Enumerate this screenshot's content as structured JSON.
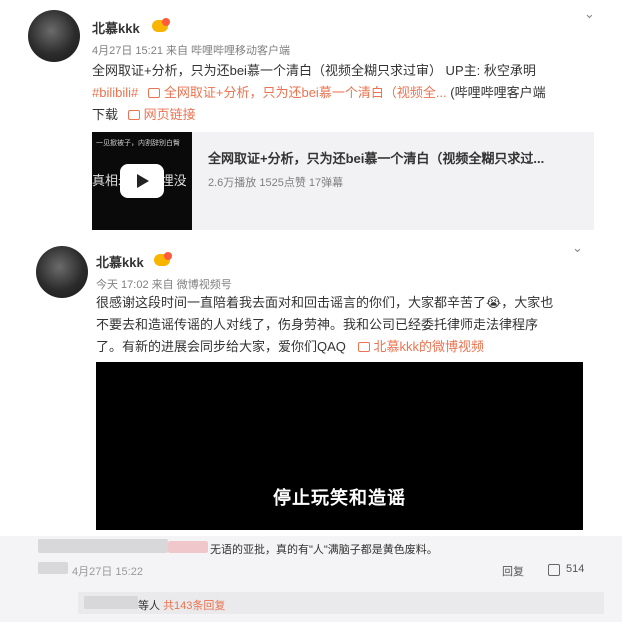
{
  "post1": {
    "username": "北慕kkk",
    "meta": "4月27日 15:21 来自 哔哩哔哩移动客户端",
    "text_line1": "全网取证+分析，只为还bei慕一个清白（视频全糊只求过审） UP主: 秋空承明",
    "hashtag": "#bilibili#",
    "link_text": "全网取证+分析，只为还bei慕一个清白（视频全...",
    "source": "(哔哩哔哩客户端",
    "source2": "下载",
    "web_link": "网页链接",
    "card": {
      "thumb_top": "一见掀被子，内割辞别白臀",
      "thumb_mid": "真相永不 被埋没",
      "title": "全网取证+分析，只为还bei慕一个清白（视频全糊只求过...",
      "stats": "2.6万播放  1525点赞  17弹幕"
    }
  },
  "post2": {
    "username": "北慕kkk",
    "meta": "今天 17:02 来自 微博视频号",
    "text_line1": "很感谢这段时间一直陪着我去面对和回击谣言的你们，大家都辛苦了😭，大家也",
    "text_line2": "不要去和造谣传谣的人对线了，伤身劳神。我和公司已经委托律师走法律程序",
    "text_line3": "了。有新的进展会同步给大家，爱你们QAQ",
    "video_link": "北慕kkk的微博视频",
    "video_caption": "停止玩笑和造谣"
  },
  "comment": {
    "text": "无语的亚批，真的有\"人\"满脑子都是黄色废料。",
    "time": "4月27日 15:22",
    "reply_label": "回复",
    "like_count": "514",
    "sub_suffix": "等人",
    "sub_link": "共143条回复"
  }
}
